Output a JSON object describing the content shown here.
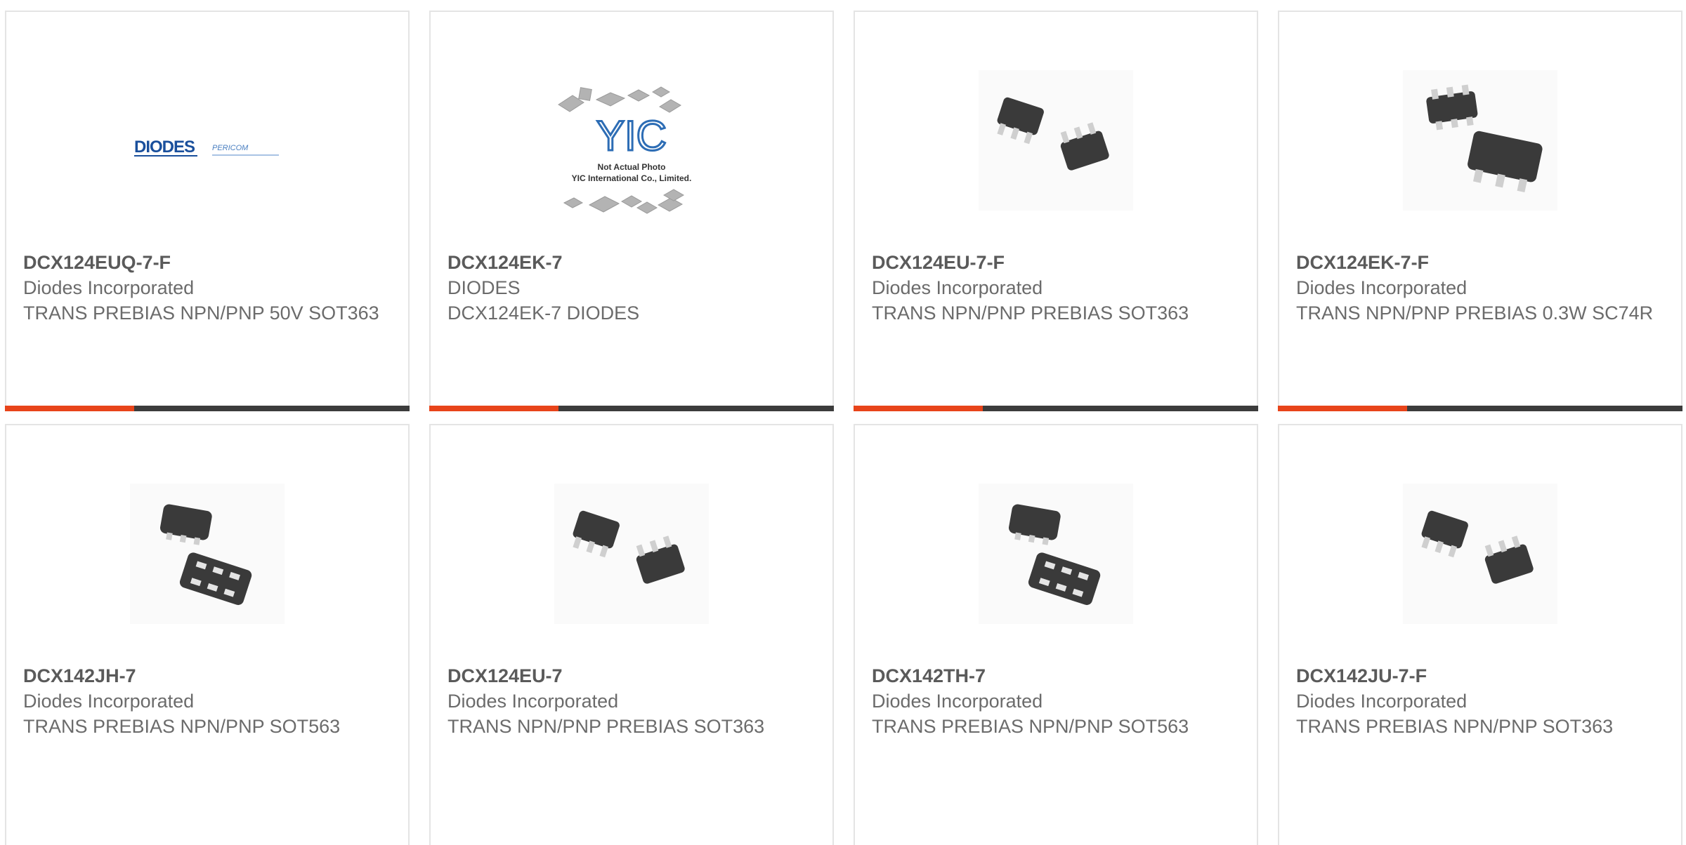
{
  "accent_color": "#e8441a",
  "bar_color": "#3c3c3c",
  "cards": [
    {
      "part_number": "DCX124EUQ-7-F",
      "manufacturer": "Diodes Incorporated",
      "description": "TRANS PREBIAS NPN/PNP 50V SOT363",
      "image": "diodes-pericom-logo",
      "logo_text": "DIODES",
      "logo_subtext": "PERICOM"
    },
    {
      "part_number": "DCX124EK-7",
      "manufacturer": "DIODES",
      "description": "DCX124EK-7 DIODES",
      "image": "yic-placeholder",
      "placeholder_logo": "YIC",
      "placeholder_line1": "Not Actual Photo",
      "placeholder_line2": "YIC International Co., Limited."
    },
    {
      "part_number": "DCX124EU-7-F",
      "manufacturer": "Diodes Incorporated",
      "description": "TRANS NPN/PNP PREBIAS SOT363",
      "image": "sot363-chip-photo"
    },
    {
      "part_number": "DCX124EK-7-F",
      "manufacturer": "Diodes Incorporated",
      "description": "TRANS NPN/PNP PREBIAS 0.3W SC74R",
      "image": "sc74r-chip-photo"
    },
    {
      "part_number": "DCX142JH-7",
      "manufacturer": "Diodes Incorporated",
      "description": "TRANS PREBIAS NPN/PNP SOT563",
      "image": "sot563-chip-photo"
    },
    {
      "part_number": "DCX124EU-7",
      "manufacturer": "Diodes Incorporated",
      "description": "TRANS NPN/PNP PREBIAS SOT363",
      "image": "sot363-chip-photo"
    },
    {
      "part_number": "DCX142TH-7",
      "manufacturer": "Diodes Incorporated",
      "description": "TRANS PREBIAS NPN/PNP SOT563",
      "image": "sot563-chip-photo"
    },
    {
      "part_number": "DCX142JU-7-F",
      "manufacturer": "Diodes Incorporated",
      "description": "TRANS PREBIAS NPN/PNP SOT363",
      "image": "sot363-chip-photo"
    }
  ]
}
